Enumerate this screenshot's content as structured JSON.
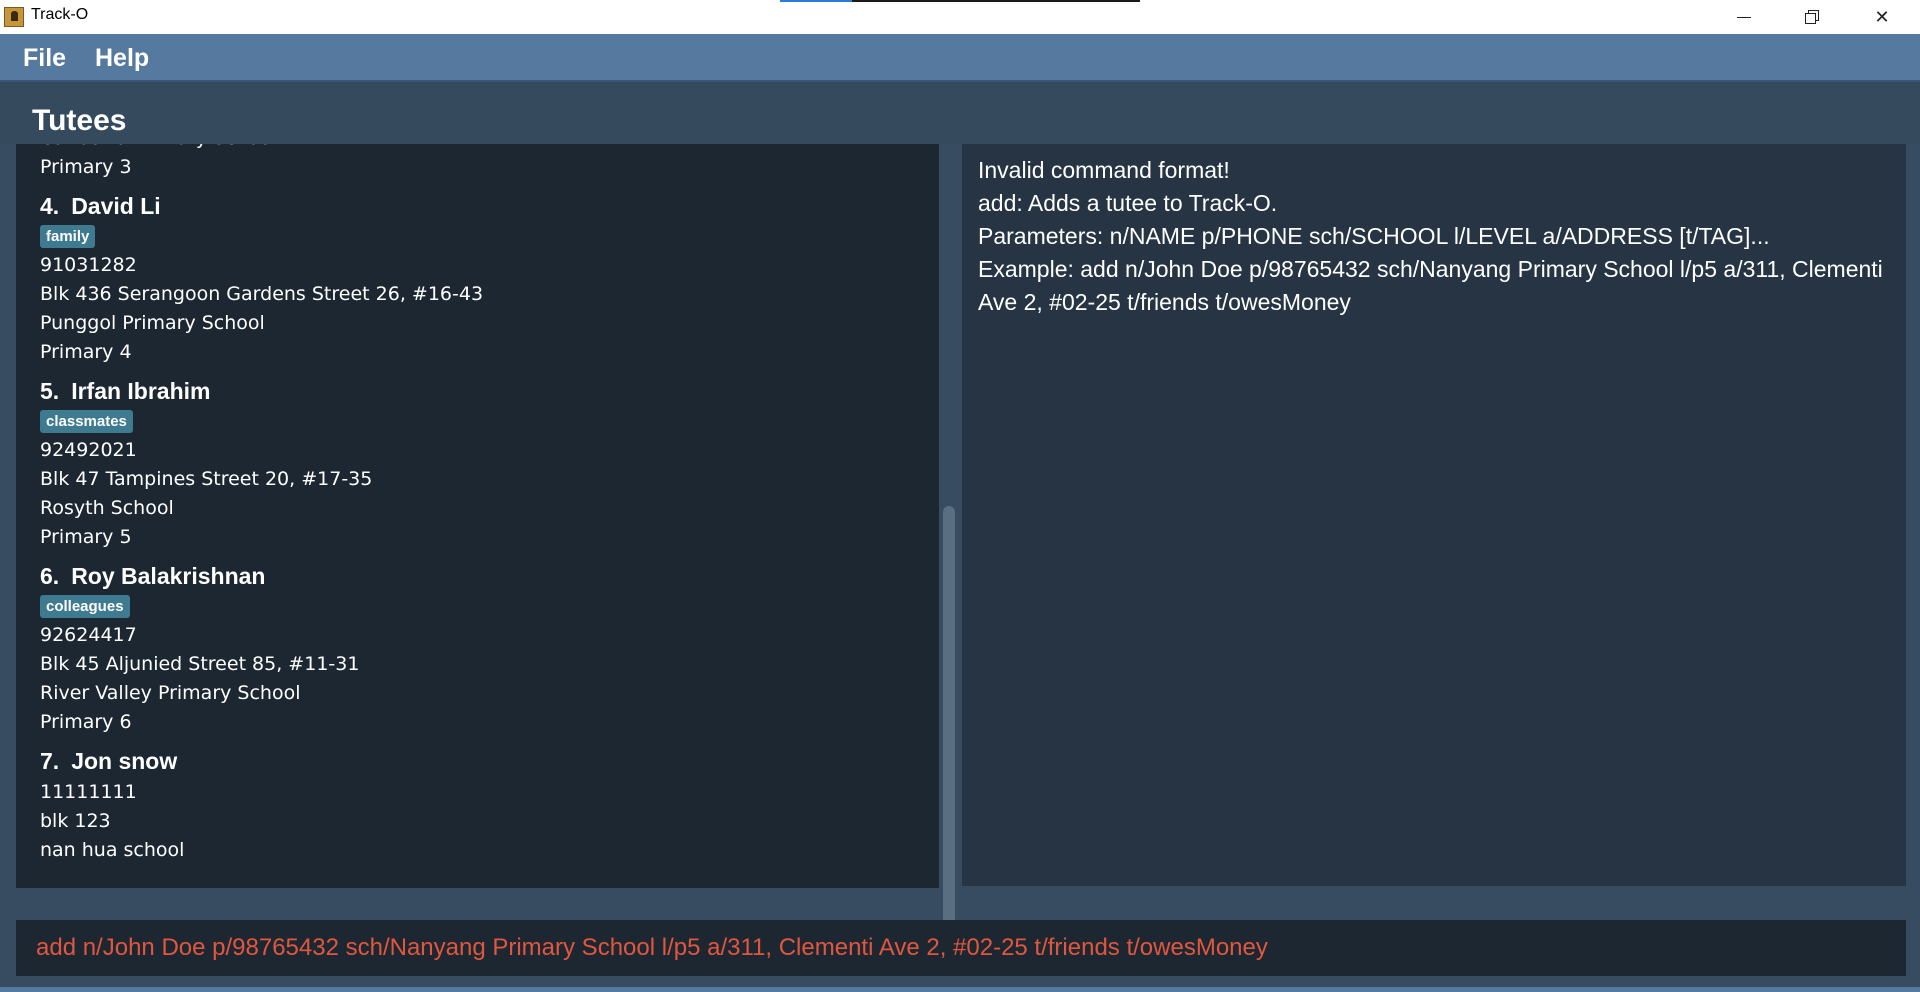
{
  "window": {
    "title": "Track-O",
    "progress_fraction": 0.2
  },
  "menu": {
    "file": "File",
    "help": "Help"
  },
  "header": {
    "title": "Tutees"
  },
  "tutees": [
    {
      "partial": true,
      "lines": [
        "Canberra Primary School",
        "Primary 3"
      ]
    },
    {
      "index": "4.",
      "name": "David Li",
      "tag": "family",
      "phone": "91031282",
      "address": "Blk 436 Serangoon Gardens Street 26, #16-43",
      "school": "Punggol Primary School",
      "level": "Primary 4"
    },
    {
      "index": "5.",
      "name": "Irfan Ibrahim",
      "tag": "classmates",
      "phone": "92492021",
      "address": "Blk 47 Tampines Street 20, #17-35",
      "school": "Rosyth School",
      "level": "Primary 5"
    },
    {
      "index": "6.",
      "name": "Roy Balakrishnan",
      "tag": "colleagues",
      "phone": "92624417",
      "address": "Blk 45 Aljunied Street 85, #11-31",
      "school": "River Valley Primary School",
      "level": "Primary 6"
    },
    {
      "index": "7.",
      "name": "Jon snow",
      "phone": "11111111",
      "address": "blk 123",
      "school": "nan hua school"
    }
  ],
  "result": {
    "text": "Invalid command format!\nadd: Adds a tutee to Track-O.\nParameters: n/NAME p/PHONE sch/SCHOOL l/LEVEL a/ADDRESS [t/TAG]...\nExample: add n/John Doe p/98765432 sch/Nanyang Primary School l/p5 a/311, Clementi Ave 2, #02-25 t/friends t/owesMoney"
  },
  "command": {
    "value": "add n/John Doe p/98765432 sch/Nanyang Primary School l/p5 a/311, Clementi Ave 2, #02-25 t/friends t/owesMoney"
  },
  "colors": {
    "menubar": "#5679a0",
    "panel_bg": "#1d2732",
    "tag_bg": "#3e7b91",
    "command_text": "#e0573e"
  }
}
